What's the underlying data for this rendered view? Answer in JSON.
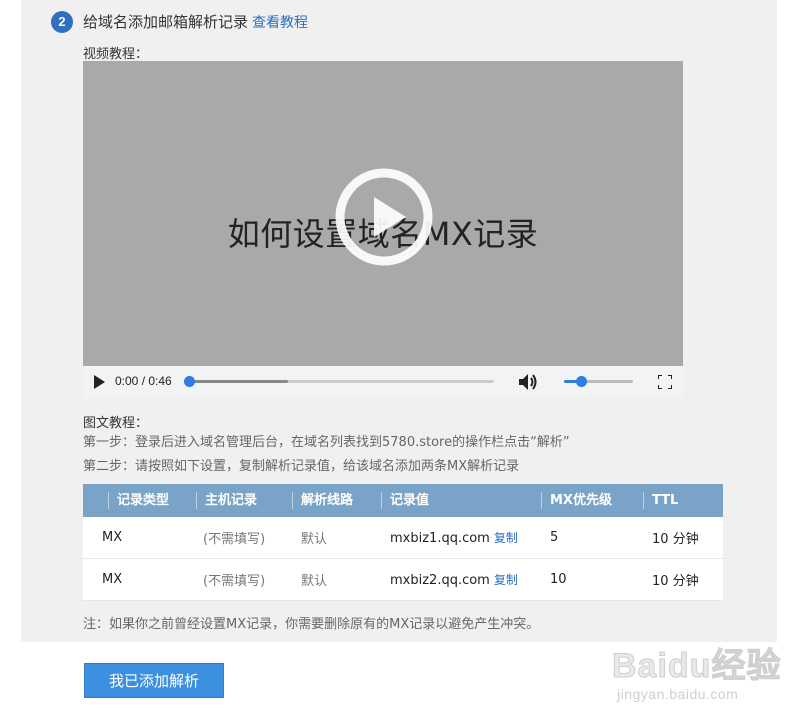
{
  "step": {
    "number": "2",
    "title": "给域名添加邮箱解析记录",
    "tutorial_link": "查看教程"
  },
  "video": {
    "section_label": "视频教程：",
    "caption": "如何设置域名MX记录",
    "time": "0:00 / 0:46",
    "progress": 0.0,
    "buffered": 0.33,
    "volume": 0.25
  },
  "text_tutorial": {
    "section_label": "图文教程：",
    "step1": "第一步：登录后进入域名管理后台，在域名列表找到5780.store的操作栏点击“解析”",
    "step2": "第二步：请按照如下设置，复制解析记录值，给该域名添加两条MX解析记录"
  },
  "table": {
    "headers": [
      "记录类型",
      "主机记录",
      "解析线路",
      "记录值",
      "MX优先级",
      "TTL"
    ],
    "rows": [
      {
        "type": "MX",
        "host": "(不需填写)",
        "line": "默认",
        "value": "mxbiz1.qq.com",
        "copy": "复制",
        "priority": "5",
        "ttl": "10 分钟"
      },
      {
        "type": "MX",
        "host": "(不需填写)",
        "line": "默认",
        "value": "mxbiz2.qq.com",
        "copy": "复制",
        "priority": "10",
        "ttl": "10 分钟"
      }
    ]
  },
  "note": "注：如果你之前曾经设置MX记录，你需要删除原有的MX记录以避免产生冲突。",
  "actions": {
    "done_button": "我已添加解析"
  },
  "watermark": {
    "logo_text": "Baidu经验",
    "domain": "jingyan.baidu.com"
  },
  "colors": {
    "accent": "#2e6fc1",
    "table_header": "#7aa3c8",
    "button": "#3d8fe0",
    "link": "#2a6fc8",
    "video_bg": "#a9a9a9"
  }
}
